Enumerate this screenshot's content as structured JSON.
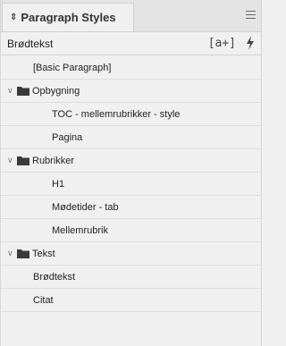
{
  "panel": {
    "tab_title": "Paragraph Styles",
    "current_style": "Brødtekst",
    "new_override_label": "[a+]"
  },
  "styles": [
    {
      "label": "[Basic Paragraph]",
      "type": "style",
      "indent": 1
    },
    {
      "label": "Opbygning",
      "type": "group",
      "indent": 0
    },
    {
      "label": "TOC - mellemrubrikker - style",
      "type": "style",
      "indent": 2
    },
    {
      "label": "Pagina",
      "type": "style",
      "indent": 2
    },
    {
      "label": "Rubrikker",
      "type": "group",
      "indent": 0
    },
    {
      "label": "H1",
      "type": "style",
      "indent": 2
    },
    {
      "label": "Mødetider - tab",
      "type": "style",
      "indent": 2
    },
    {
      "label": "Mellemrubrik",
      "type": "style",
      "indent": 2
    },
    {
      "label": "Tekst",
      "type": "group",
      "indent": 0
    },
    {
      "label": "Brødtekst",
      "type": "style",
      "indent": 1
    },
    {
      "label": "Citat",
      "type": "style",
      "indent": 1
    }
  ],
  "icons": {
    "tab_arrow": "updown-arrow-icon",
    "panel_menu": "panel-menu-icon",
    "group_folder": "folder-icon",
    "group_chevron": "chevron-down-icon",
    "override": "lightning-icon"
  }
}
